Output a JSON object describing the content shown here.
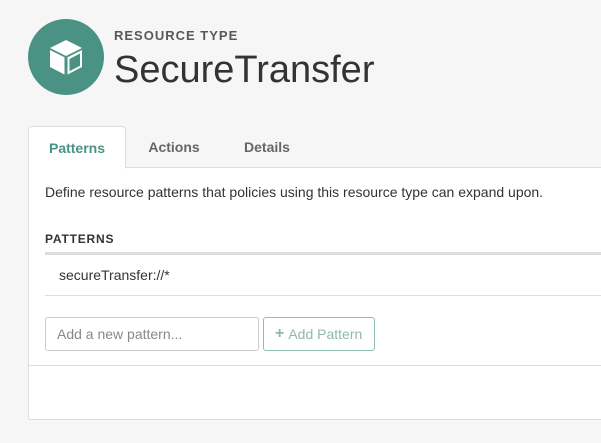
{
  "header": {
    "icon": "cube-icon",
    "eyebrow": "RESOURCE TYPE",
    "title": "SecureTransfer"
  },
  "tabs": [
    {
      "label": "Patterns",
      "active": true
    },
    {
      "label": "Actions",
      "active": false
    },
    {
      "label": "Details",
      "active": false
    }
  ],
  "patterns_panel": {
    "description": "Define resource patterns that policies using this resource type can expand upon.",
    "heading": "PATTERNS",
    "items": [
      "secureTransfer://*"
    ],
    "new_pattern_placeholder": "Add a new pattern...",
    "add_button_label": "Add Pattern",
    "add_button_icon": "plus-icon"
  },
  "colors": {
    "accent": "#4a9384",
    "page_background": "#f6f6f6",
    "border": "#dddddd"
  }
}
